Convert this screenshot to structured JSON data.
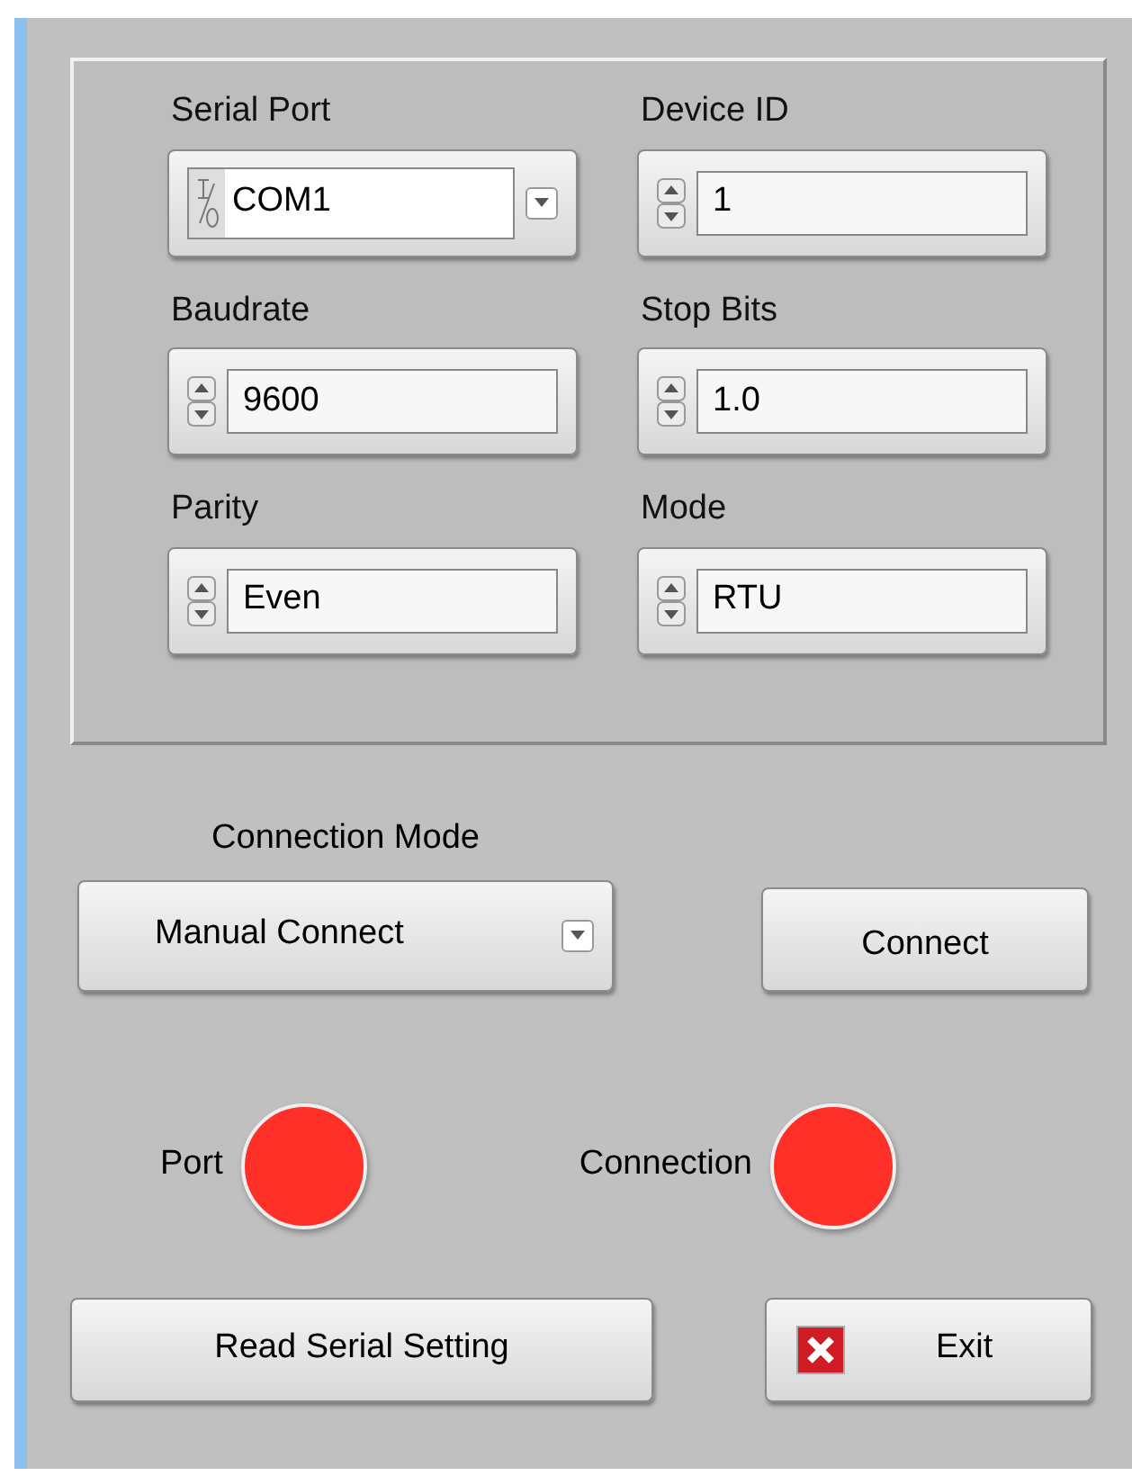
{
  "settings": [
    {
      "label": "Serial Port",
      "kind": "io",
      "value": "COM1"
    },
    {
      "label": "Device ID",
      "kind": "numeric",
      "value": "1"
    },
    {
      "label": "Baudrate",
      "kind": "numeric",
      "value": "9600"
    },
    {
      "label": "Stop Bits",
      "kind": "numeric",
      "value": "1.0"
    },
    {
      "label": "Parity",
      "kind": "numeric",
      "value": "Even"
    },
    {
      "label": "Mode",
      "kind": "numeric",
      "value": "RTU"
    }
  ],
  "connection_mode": {
    "label": "Connection Mode",
    "value": "Manual Connect"
  },
  "connect_button": "Connect",
  "indicators": [
    {
      "label": "Port",
      "on": false
    },
    {
      "label": "Connection",
      "on": false
    }
  ],
  "read_button": "Read Serial Setting",
  "exit_button": "Exit"
}
